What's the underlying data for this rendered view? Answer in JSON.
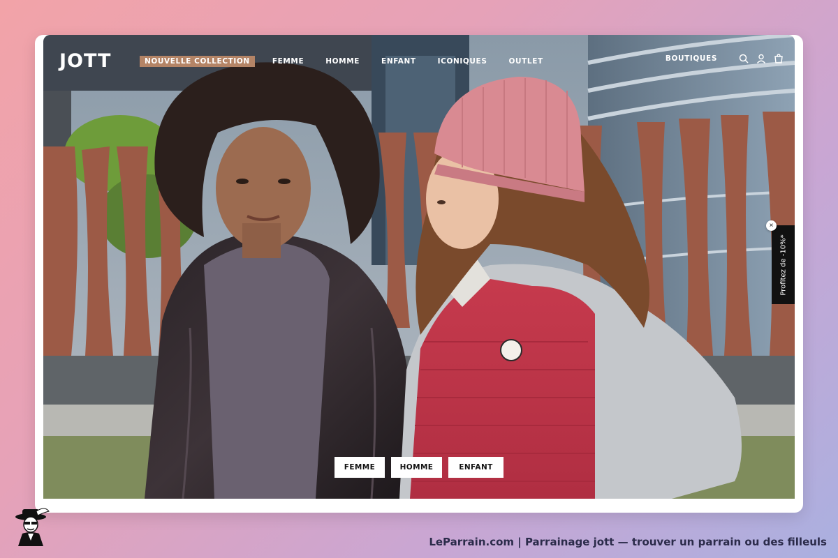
{
  "brand": {
    "logo": "JOTT"
  },
  "nav": {
    "links": [
      {
        "label": "NOUVELLE COLLECTION",
        "highlighted": true
      },
      {
        "label": "FEMME"
      },
      {
        "label": "HOMME"
      },
      {
        "label": "ENFANT"
      },
      {
        "label": "ICONIQUES"
      },
      {
        "label": "OUTLET"
      }
    ],
    "stores_label": "BOUTIQUES",
    "icons": [
      "search-icon",
      "account-icon",
      "cart-icon"
    ]
  },
  "hero": {
    "buttons": [
      "FEMME",
      "HOMME",
      "ENFANT"
    ]
  },
  "promo": {
    "text": "Profitez de -10%*",
    "close_glyph": "×"
  },
  "footer": {
    "text": "LeParrain.com | Parrainage jott — trouver un parrain ou des filleuls"
  },
  "colors": {
    "highlight": "#b48466",
    "promo_bg": "#111111",
    "vest_red": "#c63a4d",
    "beanie_pink": "#d98a92",
    "rust_panel": "#9c5a46"
  }
}
